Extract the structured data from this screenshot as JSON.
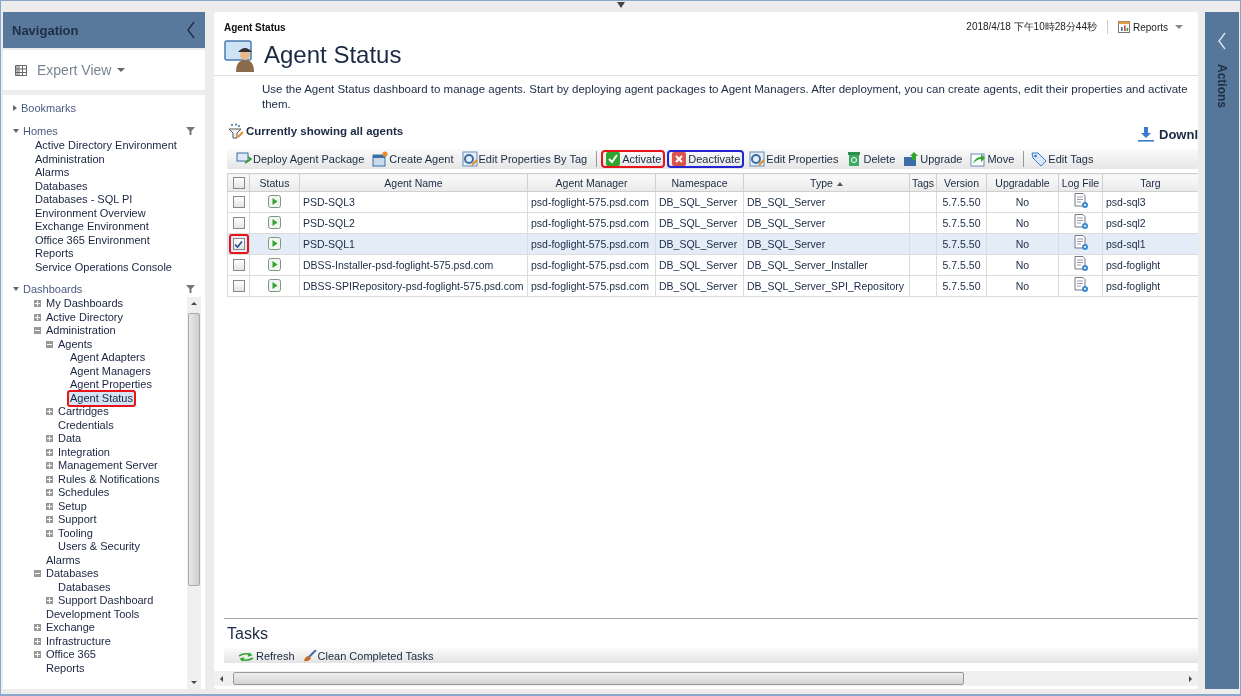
{
  "navigation": {
    "title": "Navigation",
    "view": "Expert View",
    "sections": [
      {
        "label": "Bookmarks",
        "expanded": false
      },
      {
        "label": "Homes",
        "expanded": true,
        "items": [
          {
            "label": "Active Directory Environment",
            "kind": "leaf",
            "selected": false
          },
          {
            "label": "Administration",
            "kind": "leaf",
            "selected": false
          },
          {
            "label": "Alarms",
            "kind": "leaf",
            "selected": false
          },
          {
            "label": "Databases",
            "kind": "leaf",
            "selected": false
          },
          {
            "label": "Databases - SQL PI",
            "kind": "leaf",
            "selected": false
          },
          {
            "label": "Environment Overview",
            "kind": "leaf",
            "selected": false
          },
          {
            "label": "Exchange Environment",
            "kind": "leaf",
            "selected": false
          },
          {
            "label": "Office 365 Environment",
            "kind": "leaf",
            "selected": false
          },
          {
            "label": "Reports",
            "kind": "leaf",
            "selected": false
          },
          {
            "label": "Service Operations Console",
            "kind": "leaf",
            "selected": false
          }
        ]
      },
      {
        "label": "Dashboards",
        "expanded": true,
        "items": [
          {
            "label": "My Dashboards",
            "kind": "folder",
            "expanded": false,
            "selected": false
          },
          {
            "label": "Active Directory",
            "kind": "folder",
            "expanded": false,
            "selected": false
          },
          {
            "label": "Administration",
            "kind": "folder",
            "expanded": true,
            "selected": false,
            "children": [
              {
                "label": "Agents",
                "kind": "folder",
                "expanded": true,
                "selected": false,
                "children": [
                  {
                    "label": "Agent Adapters",
                    "kind": "leaf",
                    "selected": false
                  },
                  {
                    "label": "Agent Managers",
                    "kind": "leaf",
                    "selected": false
                  },
                  {
                    "label": "Agent Properties",
                    "kind": "leaf",
                    "selected": false
                  },
                  {
                    "label": "Agent Status",
                    "kind": "leaf",
                    "selected": true,
                    "color": "#e8141c"
                  }
                ]
              },
              {
                "label": "Cartridges",
                "kind": "folder",
                "expanded": false,
                "selected": false
              },
              {
                "label": "Credentials",
                "kind": "leaf",
                "selected": false
              },
              {
                "label": "Data",
                "kind": "folder",
                "expanded": false,
                "selected": false
              },
              {
                "label": "Integration",
                "kind": "folder",
                "expanded": false,
                "selected": false
              },
              {
                "label": "Management Server",
                "kind": "folder",
                "expanded": false,
                "selected": false
              },
              {
                "label": "Rules & Notifications",
                "kind": "folder",
                "expanded": false,
                "selected": false
              },
              {
                "label": "Schedules",
                "kind": "folder",
                "expanded": false,
                "selected": false
              },
              {
                "label": "Setup",
                "kind": "folder",
                "expanded": false,
                "selected": false
              },
              {
                "label": "Support",
                "kind": "folder",
                "expanded": false,
                "selected": false
              },
              {
                "label": "Tooling",
                "kind": "folder",
                "expanded": false,
                "selected": false
              },
              {
                "label": "Users & Security",
                "kind": "leaf",
                "selected": false
              }
            ]
          },
          {
            "label": "Alarms",
            "kind": "leaf",
            "selected": false
          },
          {
            "label": "Databases",
            "kind": "folder",
            "expanded": true,
            "selected": false,
            "children": [
              {
                "label": "Databases",
                "kind": "leaf",
                "selected": false
              },
              {
                "label": "Support Dashboard",
                "kind": "folder",
                "expanded": false,
                "selected": false
              }
            ]
          },
          {
            "label": "Development Tools",
            "kind": "leaf",
            "selected": false
          },
          {
            "label": "Exchange",
            "kind": "folder",
            "expanded": false,
            "selected": false
          },
          {
            "label": "Infrastructure",
            "kind": "folder",
            "expanded": false,
            "selected": false
          },
          {
            "label": "Office 365",
            "kind": "folder",
            "expanded": false,
            "selected": false
          },
          {
            "label": "Reports",
            "kind": "leaf",
            "selected": false
          }
        ]
      }
    ]
  },
  "header": {
    "breadcrumb": "Agent Status",
    "timestamp": "2018/4/18 下午10時28分44秒",
    "reports": "Reports",
    "title": "Agent Status",
    "description": "Use the Agent Status dashboard to manage agents. Start by deploying agent packages to Agent Managers. After deployment, you can create agents, edit their properties and activate them."
  },
  "filter_label": "Currently showing all agents",
  "download": "Downl",
  "toolbar": {
    "groups": [
      {
        "items": [
          {
            "label": "Deploy Agent Package"
          },
          {
            "label": "Create Agent"
          },
          {
            "label": "Edit Properties By Tag"
          }
        ]
      },
      {
        "items": [
          {
            "label": "Activate",
            "color": "#e8141c"
          },
          {
            "label": "Deactivate",
            "color": "#2424d0"
          },
          {
            "label": "Edit Properties"
          },
          {
            "label": "Delete"
          },
          {
            "label": "Upgrade"
          },
          {
            "label": "Move"
          }
        ]
      },
      {
        "items": [
          {
            "label": "Edit Tags"
          }
        ]
      }
    ]
  },
  "table": {
    "select_all": {
      "checked": false
    },
    "columns": [
      {
        "label": "Status",
        "sorted": false
      },
      {
        "label": "Agent Name",
        "sorted": false
      },
      {
        "label": "Agent Manager",
        "sorted": false
      },
      {
        "label": "Namespace",
        "sorted": false
      },
      {
        "label": "Type",
        "sorted": true
      },
      {
        "label": "Tags",
        "sorted": false
      },
      {
        "label": "Version",
        "sorted": false
      },
      {
        "label": "Upgradable",
        "sorted": false
      },
      {
        "label": "Log File",
        "sorted": false
      },
      {
        "label": "Targ",
        "sorted": false
      }
    ],
    "rows": [
      {
        "checked": false,
        "selected": false,
        "name": "PSD-SQL3",
        "manager": "psd-foglight-575.psd.com",
        "namespace": "DB_SQL_Server",
        "type": "DB_SQL_Server",
        "version": "5.7.5.50",
        "upgradable": "No",
        "target": "psd-sql3"
      },
      {
        "checked": false,
        "selected": false,
        "name": "PSD-SQL2",
        "manager": "psd-foglight-575.psd.com",
        "namespace": "DB_SQL_Server",
        "type": "DB_SQL_Server",
        "version": "5.7.5.50",
        "upgradable": "No",
        "target": "psd-sql2"
      },
      {
        "checked": true,
        "selected": true,
        "color": "#e8141c",
        "name": "PSD-SQL1",
        "manager": "psd-foglight-575.psd.com",
        "namespace": "DB_SQL_Server",
        "type": "DB_SQL_Server",
        "version": "5.7.5.50",
        "upgradable": "No",
        "target": "psd-sql1"
      },
      {
        "checked": false,
        "selected": false,
        "name": "DBSS-Installer-psd-foglight-575.psd.com",
        "manager": "psd-foglight-575.psd.com",
        "namespace": "DB_SQL_Server",
        "type": "DB_SQL_Server_Installer",
        "version": "5.7.5.50",
        "upgradable": "No",
        "target": "psd-foglight"
      },
      {
        "checked": false,
        "selected": false,
        "name": "DBSS-SPIRepository-psd-foglight-575.psd.com",
        "manager": "psd-foglight-575.psd.com",
        "namespace": "DB_SQL_Server",
        "type": "DB_SQL_Server_SPI_Repository",
        "version": "5.7.5.50",
        "upgradable": "No",
        "target": "psd-foglight"
      }
    ]
  },
  "tasks": {
    "title": "Tasks",
    "buttons": [
      {
        "label": "Refresh"
      },
      {
        "label": "Clean Completed Tasks"
      }
    ]
  },
  "actions_panel": {
    "title": "Actions"
  }
}
